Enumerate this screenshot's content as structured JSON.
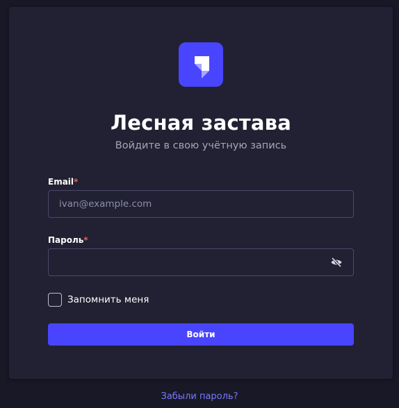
{
  "brand": {
    "accent": "#4945ff",
    "logo_icon": "strapi-logo-icon"
  },
  "auth": {
    "title": "Лесная застава",
    "subtitle": "Войдите в свою учётную запись",
    "email": {
      "label": "Email",
      "required_mark": "*",
      "placeholder": "ivan@example.com",
      "value": ""
    },
    "password": {
      "label": "Пароль",
      "required_mark": "*",
      "value": "",
      "toggle_icon": "eye-off-icon"
    },
    "remember": {
      "label": "Запомнить меня",
      "checked": false
    },
    "submit_label": "Войти",
    "forgot_label": "Забыли пароль?"
  }
}
